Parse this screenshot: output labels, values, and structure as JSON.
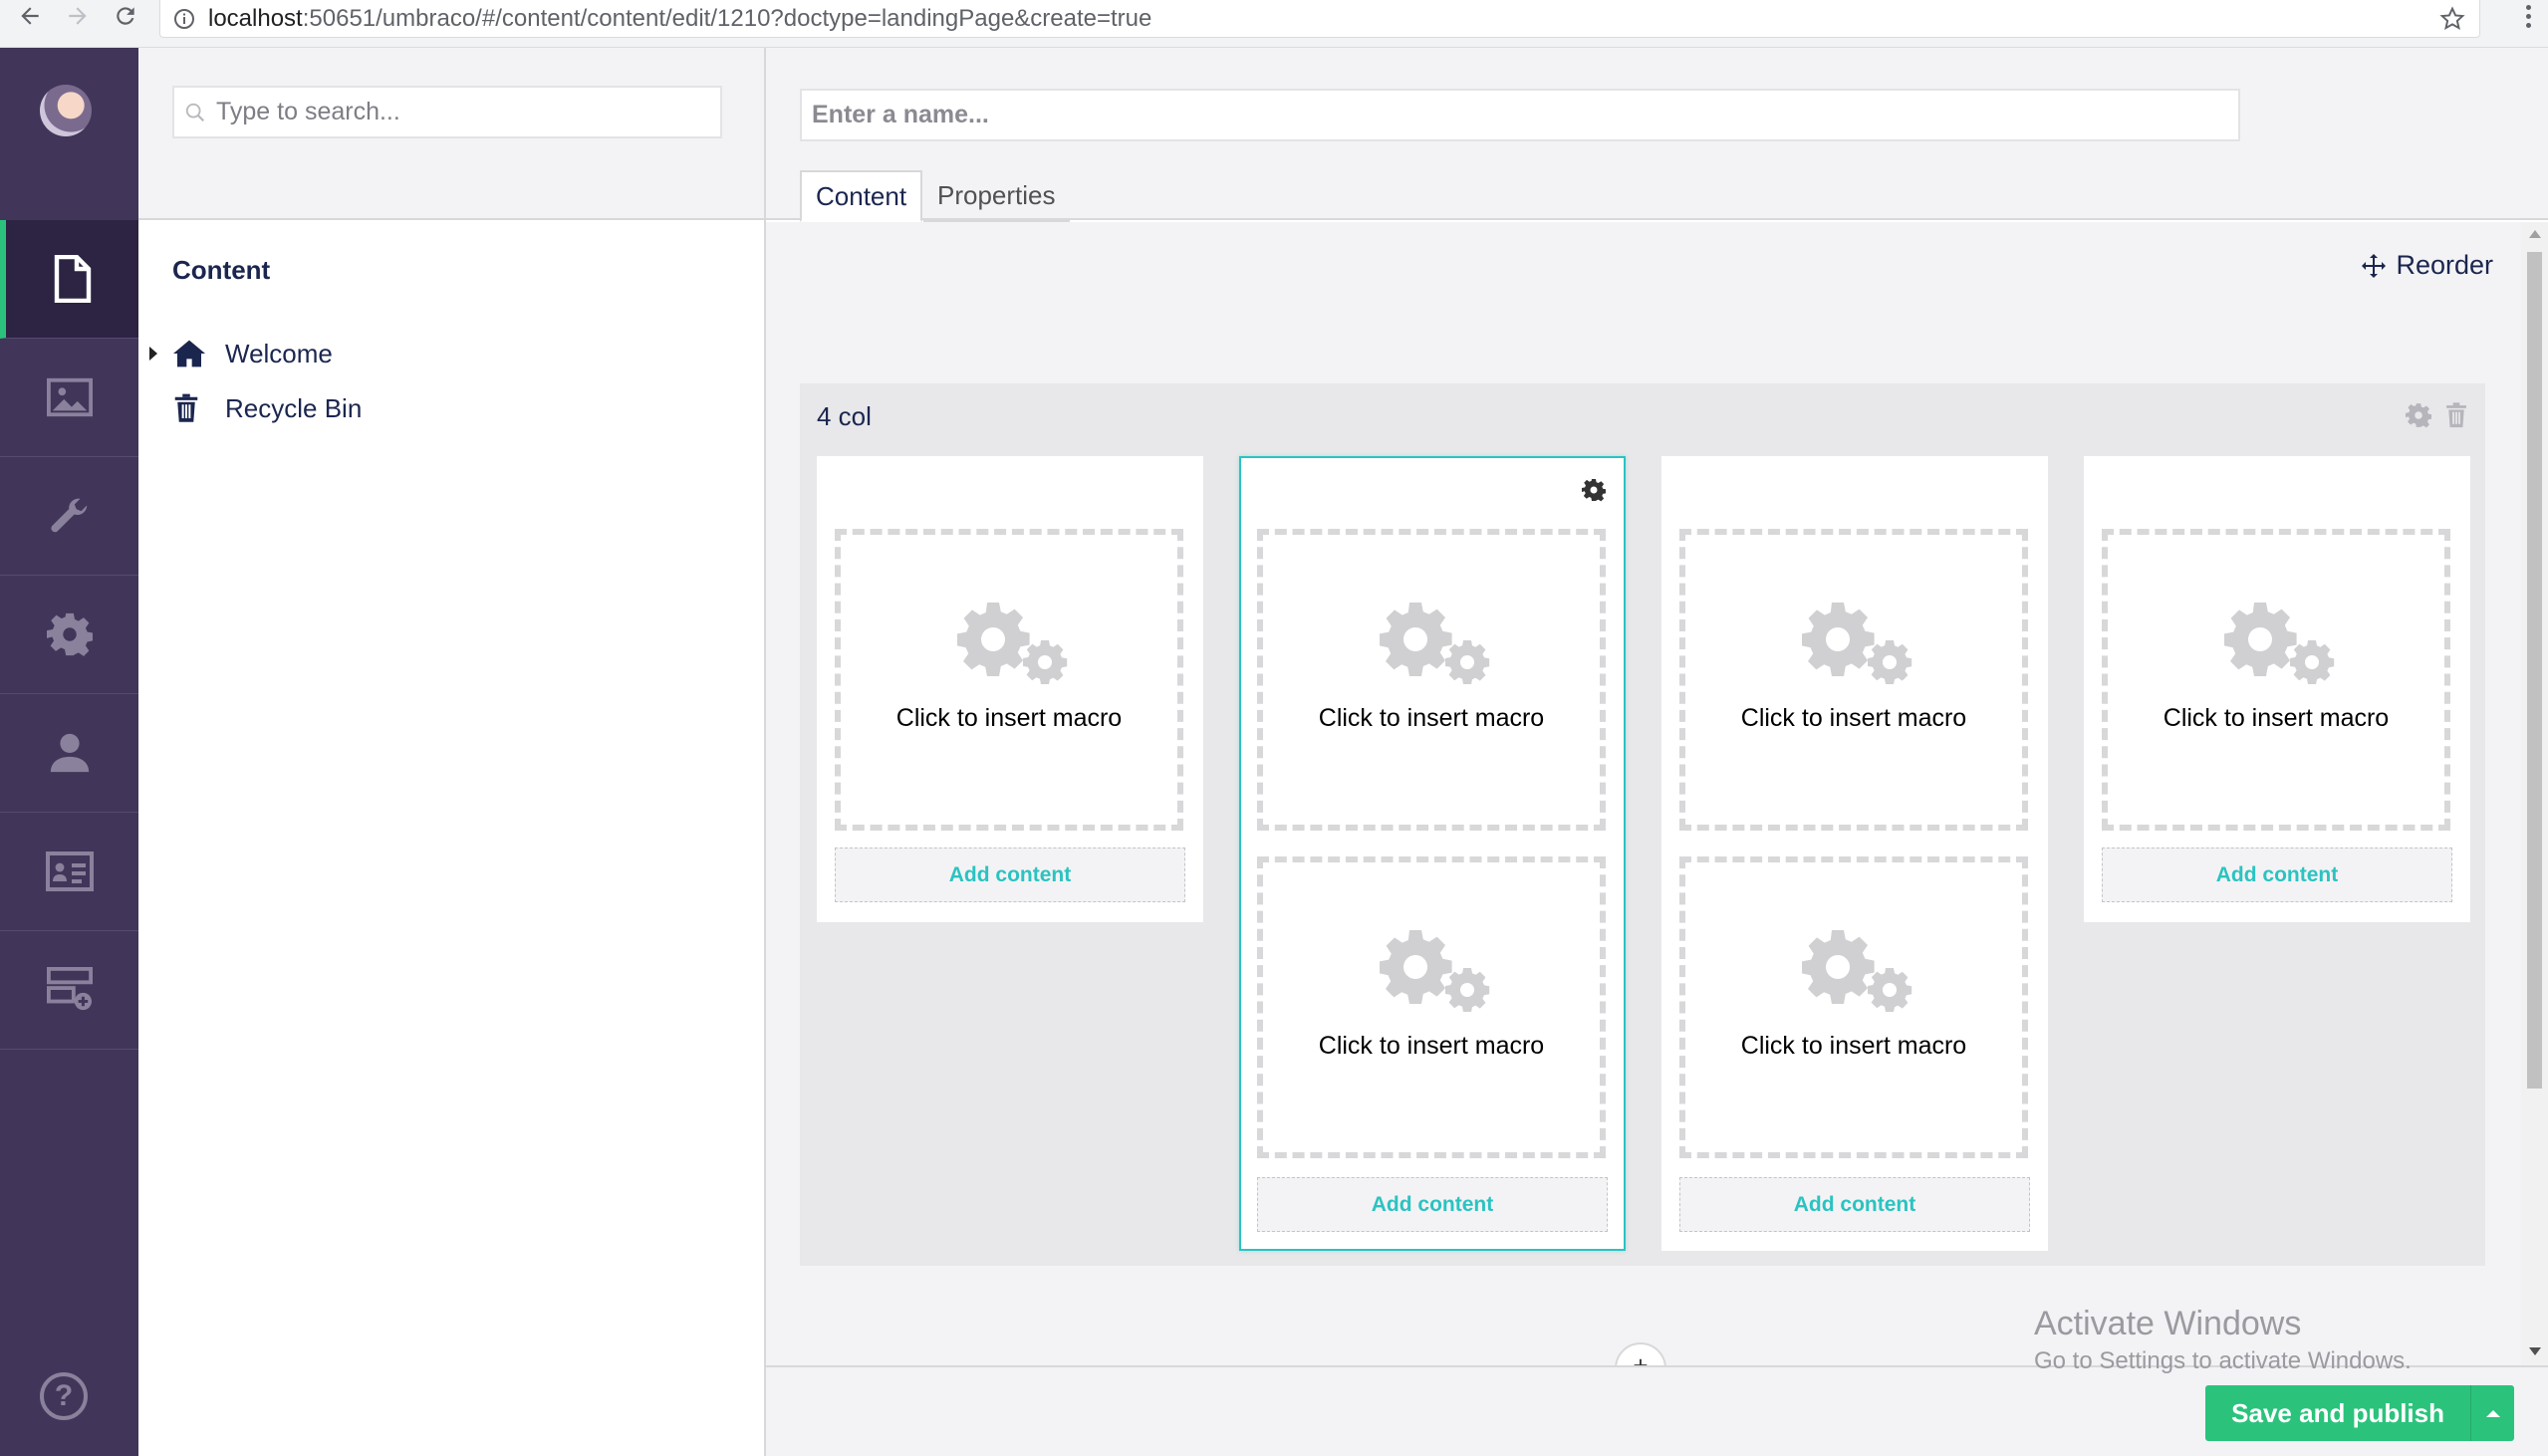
{
  "browser": {
    "url_host": "localhost",
    "url_path": ":50651/umbraco/#/content/content/edit/1210?doctype=landingPage&create=true"
  },
  "sections": [
    "content-icon",
    "media-icon",
    "settings-wrench-icon",
    "developer-gear-icon",
    "users-icon",
    "members-icon",
    "forms-icon"
  ],
  "tree": {
    "search_placeholder": "Type to search...",
    "title": "Content",
    "nodes": [
      {
        "label": "Welcome",
        "icon": "home-icon"
      },
      {
        "label": "Recycle Bin",
        "icon": "trash-icon"
      }
    ]
  },
  "editor": {
    "name_placeholder": "Enter a name...",
    "tabs": [
      "Content",
      "Properties"
    ],
    "reorder_label": "Reorder",
    "row_title": "4 col",
    "macro_label": "Click to insert macro",
    "add_content_label": "Add content",
    "publish_label": "Save and publish"
  },
  "watermark": {
    "line1": "Activate Windows",
    "line2": "Go to Settings to activate Windows."
  },
  "colors": {
    "section_bar": "#413659",
    "accent_green": "#2bc37c",
    "accent_teal": "#2bc3c1"
  }
}
